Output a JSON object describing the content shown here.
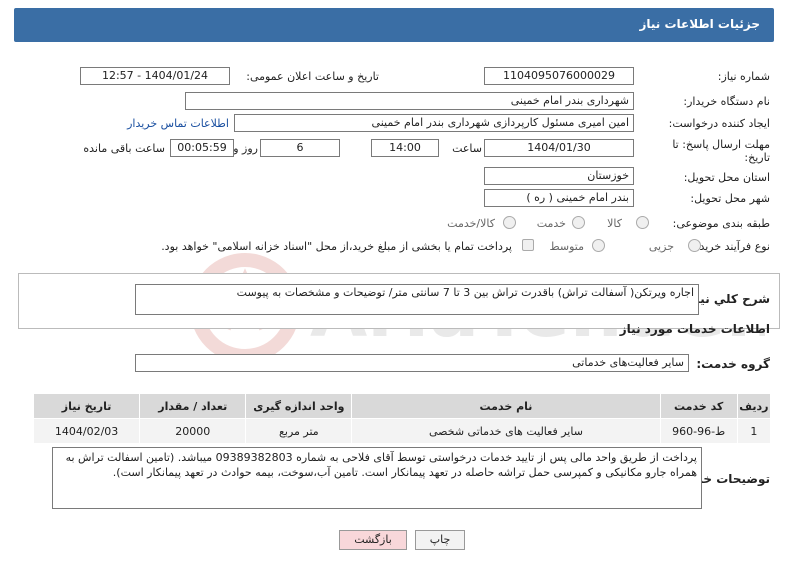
{
  "header": {
    "title": "جزئیات اطلاعات نیاز"
  },
  "labels": {
    "need_number": "شماره نیاز:",
    "announce_datetime": "تاریخ و ساعت اعلان عمومی:",
    "buyer_org": "نام دستگاه خریدار:",
    "requester": "ایجاد کننده درخواست:",
    "deadline": "مهلت ارسال پاسخ: تا تاریخ:",
    "time_word": "ساعت",
    "day_and": "روز و",
    "remaining": "ساعت باقی مانده",
    "province": "استان محل تحویل:",
    "city": "شهر محل تحویل:",
    "category": "طبقه بندی موضوعی:",
    "purchase_type": "نوع فرآیند خرید :",
    "general_desc": "شرح کلي نياز:",
    "services_info": "اطلاعات خدمات مورد نیاز",
    "service_group": "گروه خدمت:",
    "buyer_notes": "توضیحات خریدار:"
  },
  "fields": {
    "need_number": "1104095076000029",
    "announce_datetime": "1404/01/24 - 12:57",
    "buyer_org": "شهرداری بندر امام خمینی",
    "requester": "امین امیری مسئول کارپردازی شهرداری بندر امام خمینی",
    "contact_link": "اطلاعات تماس خریدار",
    "deadline_date": "1404/01/30",
    "deadline_time": "14:00",
    "days": "6",
    "remaining_time": "00:05:59",
    "province": "خوزستان",
    "city": "بندر امام خمینی ( ره )",
    "general_desc": "اجاره ویرتکن( آسفالت تراش) باقدرت تراش بین 3 تا 7 سانتی متر/ توضیحات و مشخصات به پیوست",
    "service_group": "سایر فعالیت‌های خدماتی",
    "buyer_notes": "پرداخت از طریق واحد مالی پس از تایید خدمات درخواستی توسط آقای فلاحی به شماره 09389382803 میباشد. (تامین اسفالت تراش به همراه جارو مکانیکی و کمپرسی حمل تراشه حاصله در تعهد پیمانکار است. تامین آب،سوخت، بیمه حوادث در تعهد پیمانکار است)."
  },
  "category_options": [
    "کالا",
    "خدمت",
    "کالا/خدمت"
  ],
  "purchase_options": [
    "جزیی",
    "متوسط"
  ],
  "purchase_checkbox": "پرداخت تمام یا بخشی از مبلغ خرید،از محل \"اسناد خزانه اسلامی\" خواهد بود.",
  "table": {
    "headers": [
      "ردیف",
      "کد خدمت",
      "نام خدمت",
      "واحد اندازه گیری",
      "تعداد / مقدار",
      "تاریخ نیاز"
    ],
    "rows": [
      [
        "1",
        "ط-96-960",
        "سایر فعالیت های خدماتی شخصی",
        "متر مربع",
        "20000",
        "1404/02/03"
      ]
    ]
  },
  "buttons": {
    "print": "چاپ",
    "back": "بازگشت"
  },
  "watermark": "AriaTender.net",
  "colors": {
    "header": "#3a6ea5",
    "link": "#1a4fa0",
    "back_button": "#f8d7da"
  }
}
